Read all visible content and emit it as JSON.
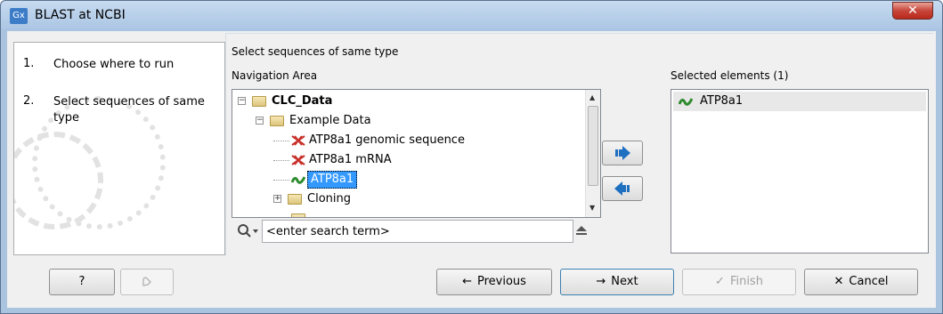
{
  "window": {
    "app_icon_text": "Gx",
    "title": "BLAST at NCBI",
    "close_glyph": "✕"
  },
  "steps": [
    {
      "num": "1.",
      "label": "Choose where to run"
    },
    {
      "num": "2.",
      "label": "Select sequences of same type"
    }
  ],
  "main": {
    "title": "Select sequences of same type",
    "navigation_title": "Navigation Area",
    "selected_title": "Selected elements (1)"
  },
  "tree": {
    "items": [
      {
        "label": "CLC_Data",
        "bold": true,
        "expander": "−",
        "icon": "database-folder-icon"
      },
      {
        "label": "Example Data",
        "expander": "−",
        "icon": "folder-icon"
      },
      {
        "label": "ATP8a1 genomic sequence",
        "icon": "nucleotide-sequence-icon"
      },
      {
        "label": "ATP8a1 mRNA",
        "icon": "nucleotide-sequence-icon"
      },
      {
        "label": "ATP8a1",
        "icon": "protein-sequence-icon",
        "selected": true
      },
      {
        "label": "Cloning",
        "expander": "+",
        "icon": "folder-icon"
      }
    ]
  },
  "search": {
    "value": "<enter search term>"
  },
  "selected_elements": [
    {
      "label": "ATP8a1",
      "icon": "protein-sequence-icon"
    }
  ],
  "buttons": {
    "help": "?",
    "previous": "Previous",
    "next": "Next",
    "finish": "Finish",
    "cancel": "Cancel"
  },
  "colors": {
    "accent": "#3399ff",
    "arrow_blue": "#1e6fc0",
    "dna_red": "#c8302a",
    "protein_green": "#2e8b2e"
  }
}
